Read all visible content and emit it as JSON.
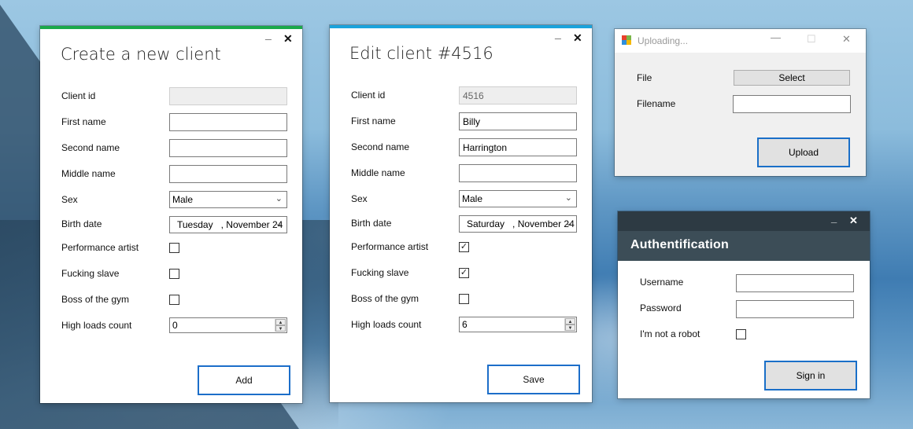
{
  "create_window": {
    "title": "Create a new client",
    "labels": {
      "client_id": "Client id",
      "first_name": "First name",
      "second_name": "Second name",
      "middle_name": "Middle name",
      "sex": "Sex",
      "birth_date": "Birth date",
      "performance_artist": "Performance artist",
      "fucking_slave": "Fucking slave",
      "boss_of_the_gym": "Boss of the gym",
      "high_loads_count": "High loads count"
    },
    "values": {
      "client_id": "",
      "first_name": "",
      "second_name": "",
      "middle_name": "",
      "sex": "Male",
      "birth_day": "Tuesday",
      "birth_date_rest": ", November 24",
      "performance_artist": false,
      "fucking_slave": false,
      "boss_of_the_gym": false,
      "high_loads_count": "0"
    },
    "button": "Add",
    "accent_color": "#1ba84a"
  },
  "edit_window": {
    "title": "Edit client #4516",
    "labels": {
      "client_id": "Client id",
      "first_name": "First name",
      "second_name": "Second name",
      "middle_name": "Middle name",
      "sex": "Sex",
      "birth_date": "Birth date",
      "performance_artist": "Performance artist",
      "fucking_slave": "Fucking slave",
      "boss_of_the_gym": "Boss of the gym",
      "high_loads_count": "High loads count"
    },
    "values": {
      "client_id": "4516",
      "first_name": "Billy",
      "second_name": "Harrington",
      "middle_name": "",
      "sex": "Male",
      "birth_day": "Saturday",
      "birth_date_rest": ", November 24",
      "performance_artist": true,
      "fucking_slave": true,
      "boss_of_the_gym": false,
      "high_loads_count": "6"
    },
    "button": "Save",
    "accent_color": "#1aa3dc"
  },
  "upload_window": {
    "title": "Uploading...",
    "file_label": "File",
    "filename_label": "Filename",
    "select_button": "Select",
    "filename_value": "",
    "upload_button": "Upload"
  },
  "auth_window": {
    "title": "Authentification",
    "username_label": "Username",
    "password_label": "Password",
    "robot_label": "I'm not a robot",
    "username_value": "",
    "password_value": "",
    "robot_checked": false,
    "signin_button": "Sign in"
  },
  "icons": {
    "minimize": "minimize-icon",
    "close": "close-icon",
    "maximize": "maximize-icon",
    "dropdown": "chevron-down-icon",
    "check": "checkmark-icon"
  },
  "glyphs": {
    "minimize": "_",
    "close": "✕",
    "maximize": "☐",
    "dropdown": "⌄",
    "check": "✓",
    "spin_up": "▲",
    "spin_down": "▼"
  }
}
